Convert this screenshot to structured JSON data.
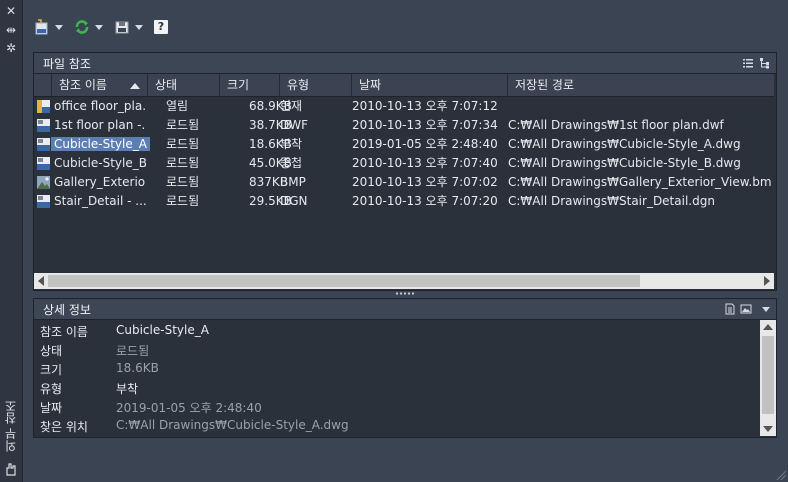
{
  "window": {
    "vertical_title": "외부 참조",
    "close_glyph": "✕",
    "pin_glyph": "⇹",
    "settings_glyph": "✲"
  },
  "toolbar": {
    "help_label": "?"
  },
  "file_refs": {
    "title": "파일 참조",
    "columns": [
      "참조 이름",
      "상태",
      "크기",
      "유형",
      "날짜",
      "저장된 경로"
    ],
    "rows": [
      {
        "name": "office floor_pla...",
        "status": "열림",
        "size": "68.9KB",
        "type": "현재",
        "date": "2010-10-13 오후 7:07:12",
        "path": "",
        "icon": "dwg-current-icon"
      },
      {
        "name": "1st floor plan -...",
        "status": "로드됨",
        "size": "38.7KB",
        "type": "DWF",
        "date": "2010-10-13 오후 7:07:34",
        "path": "C:₩All Drawings₩1st floor plan.dwf",
        "icon": "dwf-icon"
      },
      {
        "name": "Cubicle-Style_A",
        "status": "로드됨",
        "size": "18.6KB",
        "type": "부착",
        "date": "2019-01-05 오후 2:48:40",
        "path": "C:₩All Drawings₩Cubicle-Style_A.dwg",
        "icon": "dwg-icon"
      },
      {
        "name": "Cubicle-Style_B",
        "status": "로드됨",
        "size": "45.0KB",
        "type": "중첩",
        "date": "2010-10-13 오후 7:07:40",
        "path": "C:₩All Drawings₩Cubicle-Style_B.dwg",
        "icon": "dwg-icon"
      },
      {
        "name": "Gallery_Exterior...",
        "status": "로드됨",
        "size": "837KB",
        "type": "BMP",
        "date": "2010-10-13 오후 7:07:02",
        "path": "C:₩All Drawings₩Gallery_Exterior_View.bmp",
        "icon": "image-icon"
      },
      {
        "name": "Stair_Detail - ...",
        "status": "로드됨",
        "size": "29.5KB",
        "type": "DGN",
        "date": "2010-10-13 오후 7:07:20",
        "path": "C:₩All Drawings₩Stair_Detail.dgn",
        "icon": "dgn-icon"
      }
    ],
    "selected_index": 2
  },
  "details": {
    "title": "상세 정보",
    "fields": [
      {
        "label": "참조 이름",
        "value": "Cubicle-Style_A"
      },
      {
        "label": "상태",
        "value": "로드됨"
      },
      {
        "label": "크기",
        "value": "18.6KB"
      },
      {
        "label": "유형",
        "value": "부착"
      },
      {
        "label": "날짜",
        "value": "2019-01-05 오후 2:48:40"
      },
      {
        "label": "찾은 위치",
        "value": "C:₩All Drawings₩Cubicle-Style_A.dwg"
      }
    ]
  }
}
